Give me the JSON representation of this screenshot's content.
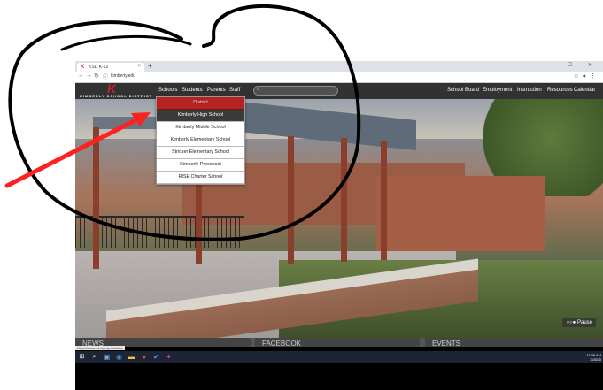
{
  "browser": {
    "tab_title": "KSD K-12",
    "new_tab": "+",
    "close_tab": "×",
    "url": "kimberly.edu",
    "window_controls": "– ☐ ✕"
  },
  "site": {
    "logo_letter": "K",
    "logo_text": "KIMBERLY SCHOOL DISTRICT",
    "nav_left": [
      "Schools",
      "Students",
      "Parents",
      "Staff"
    ],
    "nav_right": [
      "School Board",
      "Employment",
      "Instruction",
      "Resources",
      "Calendar"
    ],
    "search_placeholder": "",
    "dropdown": [
      "District",
      "Kimberly High School",
      "Kimberly Middle School",
      "Kimberly Elementary School",
      "Stricker Elementary School",
      "Kimberly Preschool",
      "RISE Charter School"
    ],
    "slideshow_control": "Pause",
    "panels": [
      "NEWS",
      "FACEBOOK",
      "EVENTS"
    ],
    "status_url": "https://www.kimberly.edu/hhs"
  },
  "taskbar": {
    "time": "11:05 AM",
    "date": "11/5/20"
  },
  "colors": {
    "brand_red": "#c8202f",
    "district_item": "#b42222",
    "hover_item": "#3a3a3a",
    "annotation_red": "#ff2020"
  }
}
